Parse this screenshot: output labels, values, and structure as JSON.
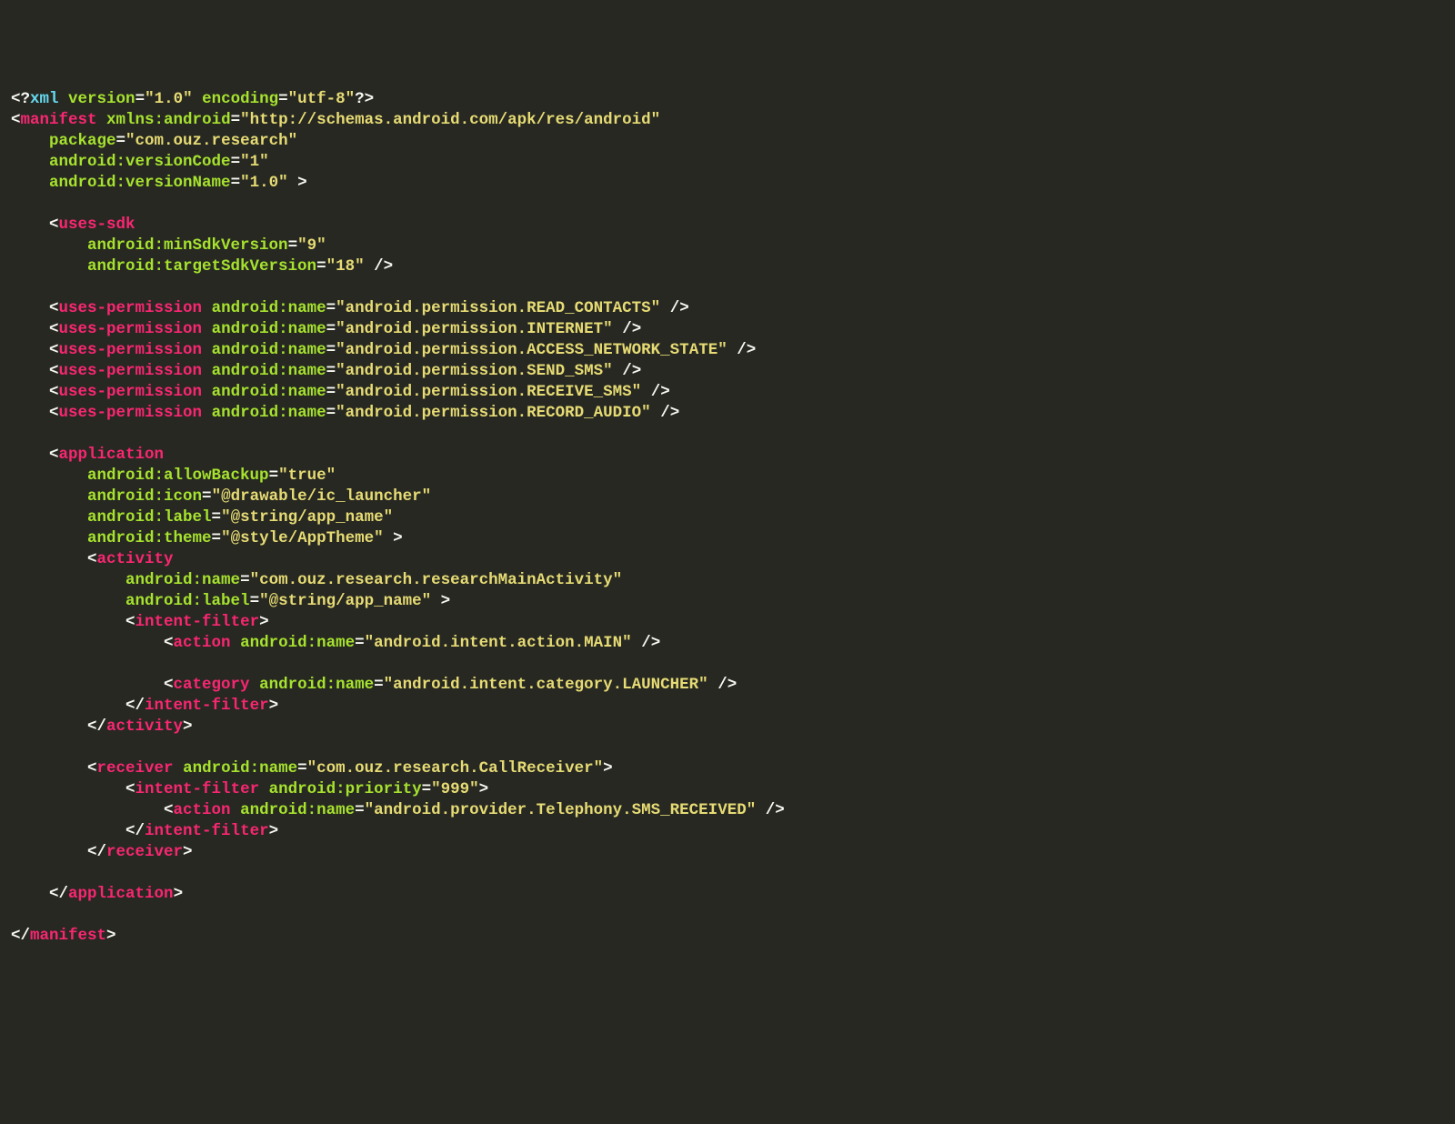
{
  "code": {
    "xmlDecl": {
      "version": "\"1.0\"",
      "encoding": "\"utf-8\""
    },
    "manifest": {
      "xmlns": "\"http://schemas.android.com/apk/res/android\"",
      "package": "\"com.ouz.research\"",
      "versionCode": "\"1\"",
      "versionName": "\"1.0\""
    },
    "usesSdk": {
      "min": "\"9\"",
      "target": "\"18\""
    },
    "perms": [
      "\"android.permission.READ_CONTACTS\"",
      "\"android.permission.INTERNET\"",
      "\"android.permission.ACCESS_NETWORK_STATE\"",
      "\"android.permission.SEND_SMS\"",
      "\"android.permission.RECEIVE_SMS\"",
      "\"android.permission.RECORD_AUDIO\""
    ],
    "app": {
      "allowBackup": "\"true\"",
      "icon": "\"@drawable/ic_launcher\"",
      "label": "\"@string/app_name\"",
      "theme": "\"@style/AppTheme\""
    },
    "activity": {
      "name": "\"com.ouz.research.researchMainActivity\"",
      "label": "\"@string/app_name\"",
      "action": "\"android.intent.action.MAIN\"",
      "category": "\"android.intent.category.LAUNCHER\""
    },
    "receiver": {
      "name": "\"com.ouz.research.CallReceiver\"",
      "priority": "\"999\"",
      "action": "\"android.provider.Telephony.SMS_RECEIVED\""
    }
  }
}
